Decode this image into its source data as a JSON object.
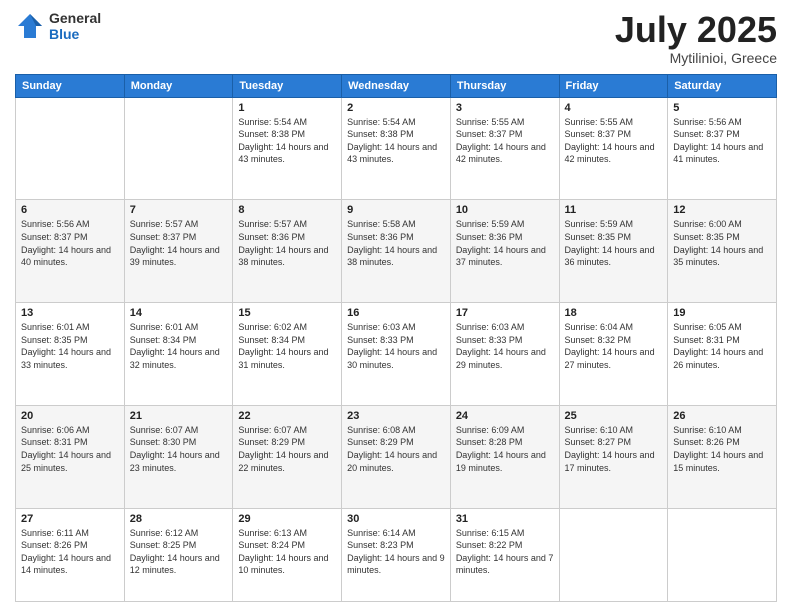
{
  "header": {
    "logo_general": "General",
    "logo_blue": "Blue",
    "title": "July 2025",
    "location": "Mytilinioi, Greece"
  },
  "days_of_week": [
    "Sunday",
    "Monday",
    "Tuesday",
    "Wednesday",
    "Thursday",
    "Friday",
    "Saturday"
  ],
  "weeks": [
    {
      "days": [
        {
          "num": "",
          "info": ""
        },
        {
          "num": "",
          "info": ""
        },
        {
          "num": "1",
          "info": "Sunrise: 5:54 AM\nSunset: 8:38 PM\nDaylight: 14 hours and 43 minutes."
        },
        {
          "num": "2",
          "info": "Sunrise: 5:54 AM\nSunset: 8:38 PM\nDaylight: 14 hours and 43 minutes."
        },
        {
          "num": "3",
          "info": "Sunrise: 5:55 AM\nSunset: 8:37 PM\nDaylight: 14 hours and 42 minutes."
        },
        {
          "num": "4",
          "info": "Sunrise: 5:55 AM\nSunset: 8:37 PM\nDaylight: 14 hours and 42 minutes."
        },
        {
          "num": "5",
          "info": "Sunrise: 5:56 AM\nSunset: 8:37 PM\nDaylight: 14 hours and 41 minutes."
        }
      ]
    },
    {
      "days": [
        {
          "num": "6",
          "info": "Sunrise: 5:56 AM\nSunset: 8:37 PM\nDaylight: 14 hours and 40 minutes."
        },
        {
          "num": "7",
          "info": "Sunrise: 5:57 AM\nSunset: 8:37 PM\nDaylight: 14 hours and 39 minutes."
        },
        {
          "num": "8",
          "info": "Sunrise: 5:57 AM\nSunset: 8:36 PM\nDaylight: 14 hours and 38 minutes."
        },
        {
          "num": "9",
          "info": "Sunrise: 5:58 AM\nSunset: 8:36 PM\nDaylight: 14 hours and 38 minutes."
        },
        {
          "num": "10",
          "info": "Sunrise: 5:59 AM\nSunset: 8:36 PM\nDaylight: 14 hours and 37 minutes."
        },
        {
          "num": "11",
          "info": "Sunrise: 5:59 AM\nSunset: 8:35 PM\nDaylight: 14 hours and 36 minutes."
        },
        {
          "num": "12",
          "info": "Sunrise: 6:00 AM\nSunset: 8:35 PM\nDaylight: 14 hours and 35 minutes."
        }
      ]
    },
    {
      "days": [
        {
          "num": "13",
          "info": "Sunrise: 6:01 AM\nSunset: 8:35 PM\nDaylight: 14 hours and 33 minutes."
        },
        {
          "num": "14",
          "info": "Sunrise: 6:01 AM\nSunset: 8:34 PM\nDaylight: 14 hours and 32 minutes."
        },
        {
          "num": "15",
          "info": "Sunrise: 6:02 AM\nSunset: 8:34 PM\nDaylight: 14 hours and 31 minutes."
        },
        {
          "num": "16",
          "info": "Sunrise: 6:03 AM\nSunset: 8:33 PM\nDaylight: 14 hours and 30 minutes."
        },
        {
          "num": "17",
          "info": "Sunrise: 6:03 AM\nSunset: 8:33 PM\nDaylight: 14 hours and 29 minutes."
        },
        {
          "num": "18",
          "info": "Sunrise: 6:04 AM\nSunset: 8:32 PM\nDaylight: 14 hours and 27 minutes."
        },
        {
          "num": "19",
          "info": "Sunrise: 6:05 AM\nSunset: 8:31 PM\nDaylight: 14 hours and 26 minutes."
        }
      ]
    },
    {
      "days": [
        {
          "num": "20",
          "info": "Sunrise: 6:06 AM\nSunset: 8:31 PM\nDaylight: 14 hours and 25 minutes."
        },
        {
          "num": "21",
          "info": "Sunrise: 6:07 AM\nSunset: 8:30 PM\nDaylight: 14 hours and 23 minutes."
        },
        {
          "num": "22",
          "info": "Sunrise: 6:07 AM\nSunset: 8:29 PM\nDaylight: 14 hours and 22 minutes."
        },
        {
          "num": "23",
          "info": "Sunrise: 6:08 AM\nSunset: 8:29 PM\nDaylight: 14 hours and 20 minutes."
        },
        {
          "num": "24",
          "info": "Sunrise: 6:09 AM\nSunset: 8:28 PM\nDaylight: 14 hours and 19 minutes."
        },
        {
          "num": "25",
          "info": "Sunrise: 6:10 AM\nSunset: 8:27 PM\nDaylight: 14 hours and 17 minutes."
        },
        {
          "num": "26",
          "info": "Sunrise: 6:10 AM\nSunset: 8:26 PM\nDaylight: 14 hours and 15 minutes."
        }
      ]
    },
    {
      "days": [
        {
          "num": "27",
          "info": "Sunrise: 6:11 AM\nSunset: 8:26 PM\nDaylight: 14 hours and 14 minutes."
        },
        {
          "num": "28",
          "info": "Sunrise: 6:12 AM\nSunset: 8:25 PM\nDaylight: 14 hours and 12 minutes."
        },
        {
          "num": "29",
          "info": "Sunrise: 6:13 AM\nSunset: 8:24 PM\nDaylight: 14 hours and 10 minutes."
        },
        {
          "num": "30",
          "info": "Sunrise: 6:14 AM\nSunset: 8:23 PM\nDaylight: 14 hours and 9 minutes."
        },
        {
          "num": "31",
          "info": "Sunrise: 6:15 AM\nSunset: 8:22 PM\nDaylight: 14 hours and 7 minutes."
        },
        {
          "num": "",
          "info": ""
        },
        {
          "num": "",
          "info": ""
        }
      ]
    }
  ]
}
